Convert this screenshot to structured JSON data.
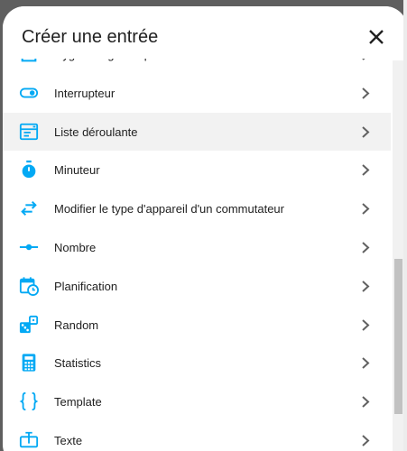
{
  "dialog": {
    "title": "Créer une entrée",
    "close_icon": "close-icon"
  },
  "items": [
    {
      "label": "Hygrostat générique",
      "icon": "hygrostat-icon"
    },
    {
      "label": "Interrupteur",
      "icon": "toggle-switch-icon"
    },
    {
      "label": "Liste déroulante",
      "icon": "dropdown-list-icon",
      "highlighted": true
    },
    {
      "label": "Minuteur",
      "icon": "timer-icon"
    },
    {
      "label": "Modifier le type d'appareil d'un commutateur",
      "icon": "swap-horizontal-icon"
    },
    {
      "label": "Nombre",
      "icon": "slider-number-icon"
    },
    {
      "label": "Planification",
      "icon": "calendar-clock-icon"
    },
    {
      "label": "Random",
      "icon": "dice-icon"
    },
    {
      "label": "Statistics",
      "icon": "calculator-icon"
    },
    {
      "label": "Template",
      "icon": "code-braces-icon"
    },
    {
      "label": "Texte",
      "icon": "text-box-icon"
    }
  ],
  "colors": {
    "icon": "#03a9f4",
    "text": "#212121",
    "chevron": "#616161",
    "hover": "#f2f2f2"
  }
}
